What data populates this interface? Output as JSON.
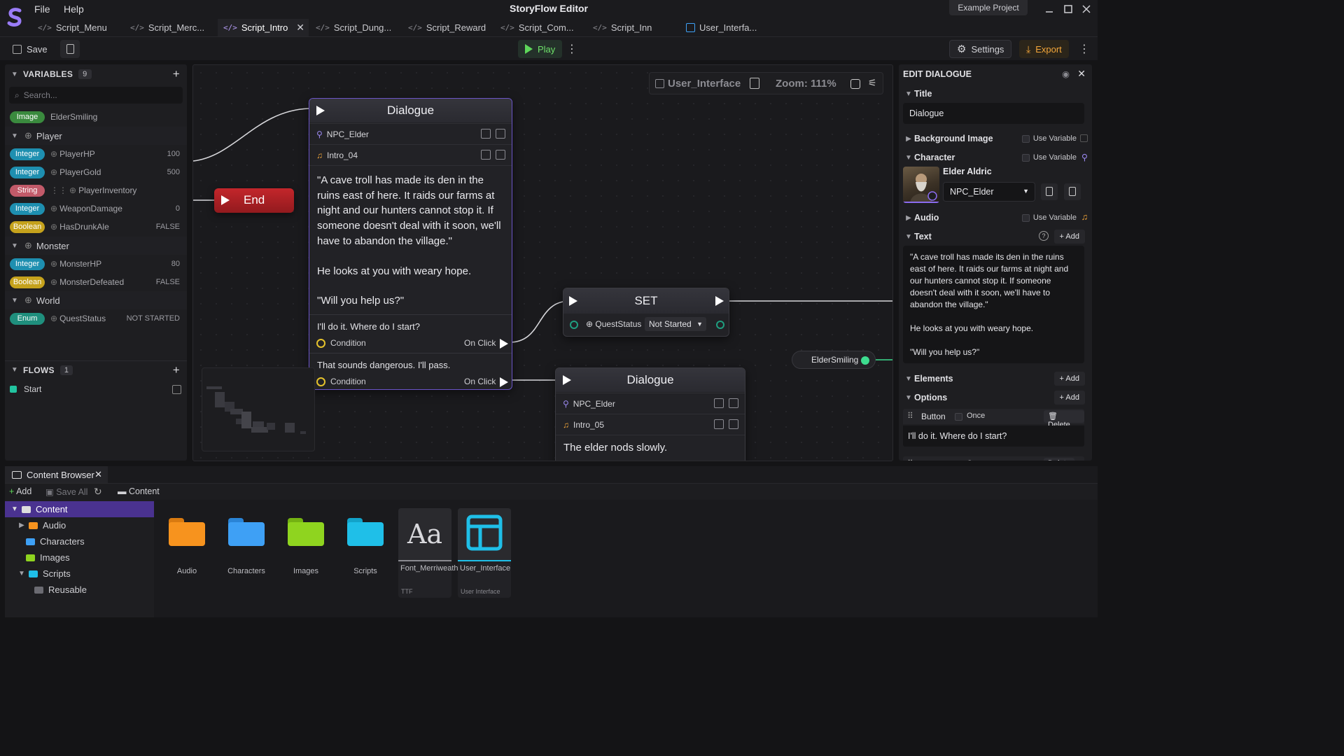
{
  "menu": {
    "file": "File",
    "help": "Help"
  },
  "app_title": "StoryFlow Editor",
  "project_name": "Example Project",
  "tabs": [
    {
      "label": "Script_Menu"
    },
    {
      "label": "Script_Merc..."
    },
    {
      "label": "Script_Intro"
    },
    {
      "label": "Script_Dung..."
    },
    {
      "label": "Script_Reward"
    },
    {
      "label": "Script_Com..."
    },
    {
      "label": "Script_Inn"
    },
    {
      "label": "User_Interfa..."
    }
  ],
  "toolbar": {
    "save": "Save",
    "play": "Play",
    "settings": "Settings",
    "export": "Export"
  },
  "variables": {
    "title": "VARIABLES",
    "count": "9",
    "search_placeholder": "Search...",
    "top_item": {
      "type": "Image",
      "name": "ElderSmiling"
    },
    "groups": [
      {
        "name": "Player",
        "items": [
          {
            "type": "Integer",
            "name": "PlayerHP",
            "value": "100"
          },
          {
            "type": "Integer",
            "name": "PlayerGold",
            "value": "500"
          },
          {
            "type": "String",
            "name": "PlayerInventory",
            "value": ""
          },
          {
            "type": "Integer",
            "name": "WeaponDamage",
            "value": "0"
          },
          {
            "type": "Boolean",
            "name": "HasDrunkAle",
            "value": "FALSE"
          }
        ]
      },
      {
        "name": "Monster",
        "items": [
          {
            "type": "Integer",
            "name": "MonsterHP",
            "value": "80"
          },
          {
            "type": "Boolean",
            "name": "MonsterDefeated",
            "value": "FALSE"
          }
        ]
      },
      {
        "name": "World",
        "items": [
          {
            "type": "Enum",
            "name": "QuestStatus",
            "value": "NOT STARTED"
          }
        ]
      }
    ]
  },
  "flows": {
    "title": "FLOWS",
    "count": "1",
    "items": [
      {
        "name": "Start"
      }
    ]
  },
  "canvas": {
    "breadcrumb": "User_Interface",
    "zoom": "Zoom: 111%",
    "end_node": "End",
    "dialogue1": {
      "title": "Dialogue",
      "character": "NPC_Elder",
      "audio": "Intro_04",
      "text_p1": "\"A cave troll has made its den in the ruins east of here. It raids our farms at night and our hunters cannot stop it. If someone doesn't deal with it soon, we'll have to abandon the village.\"",
      "text_p2": "He looks at you with weary hope.",
      "text_p3": "\"Will you help us?\"",
      "options": [
        {
          "text": "I'll do it. Where do I start?",
          "condition": "Condition",
          "trigger": "On Click"
        },
        {
          "text": "That sounds dangerous. I'll pass.",
          "condition": "Condition",
          "trigger": "On Click"
        }
      ]
    },
    "set_node": {
      "title": "SET",
      "variable": "QuestStatus",
      "value": "Not Started"
    },
    "image_pill": "ElderSmiling",
    "dialogue2": {
      "title": "Dialogue",
      "character": "NPC_Elder",
      "audio": "Intro_05",
      "text": "The elder nods slowly."
    }
  },
  "edit_panel": {
    "header": "EDIT DIALOGUE",
    "title_label": "Title",
    "title_value": "Dialogue",
    "background_label": "Background Image",
    "use_variable": "Use Variable",
    "character_label": "Character",
    "character_name": "Elder Aldric",
    "character_select": "NPC_Elder",
    "audio_label": "Audio",
    "text_label": "Text",
    "add": "+ Add",
    "text_p1": "\"A cave troll has made its den in the ruins east of here. It raids our farms at night and our hunters cannot stop it. If someone doesn't deal with it soon, we'll have to abandon the village.\"",
    "text_p2": "He looks at you with weary hope.",
    "text_p3": "\"Will you help us?\"",
    "elements_label": "Elements",
    "options_label": "Options",
    "option_button": "Button",
    "option_once": "Once",
    "option_delete": "Delete",
    "option_text": "I'll do it. Where do I start?"
  },
  "content_browser": {
    "tab": "Content Browser",
    "add": "Add",
    "save_all": "Save All",
    "path": "Content",
    "tree": [
      {
        "label": "Content"
      },
      {
        "label": "Audio"
      },
      {
        "label": "Characters"
      },
      {
        "label": "Images"
      },
      {
        "label": "Scripts"
      },
      {
        "label": "Reusable"
      }
    ],
    "tiles": [
      {
        "label": "Audio",
        "color": "#f7931e"
      },
      {
        "label": "Characters",
        "color": "#3ea0f5"
      },
      {
        "label": "Images",
        "color": "#8fd41f"
      },
      {
        "label": "Scripts",
        "color": "#1fbfe8"
      },
      {
        "label": "Font_Merriweather",
        "sub": "TTF",
        "glyph": "Aa"
      },
      {
        "label": "User_Interface",
        "sub": "User Interface"
      }
    ]
  },
  "colors": {
    "integer": "#1e8fb0",
    "boolean": "#c5a21c",
    "string": "#c25a69",
    "enum": "#1f8f7d",
    "image": "#3a8a3e",
    "accent_purple": "#8b6cf0",
    "play_green": "#5ed85a",
    "export_orange": "#f3a63a",
    "end_red": "#b81e23"
  }
}
